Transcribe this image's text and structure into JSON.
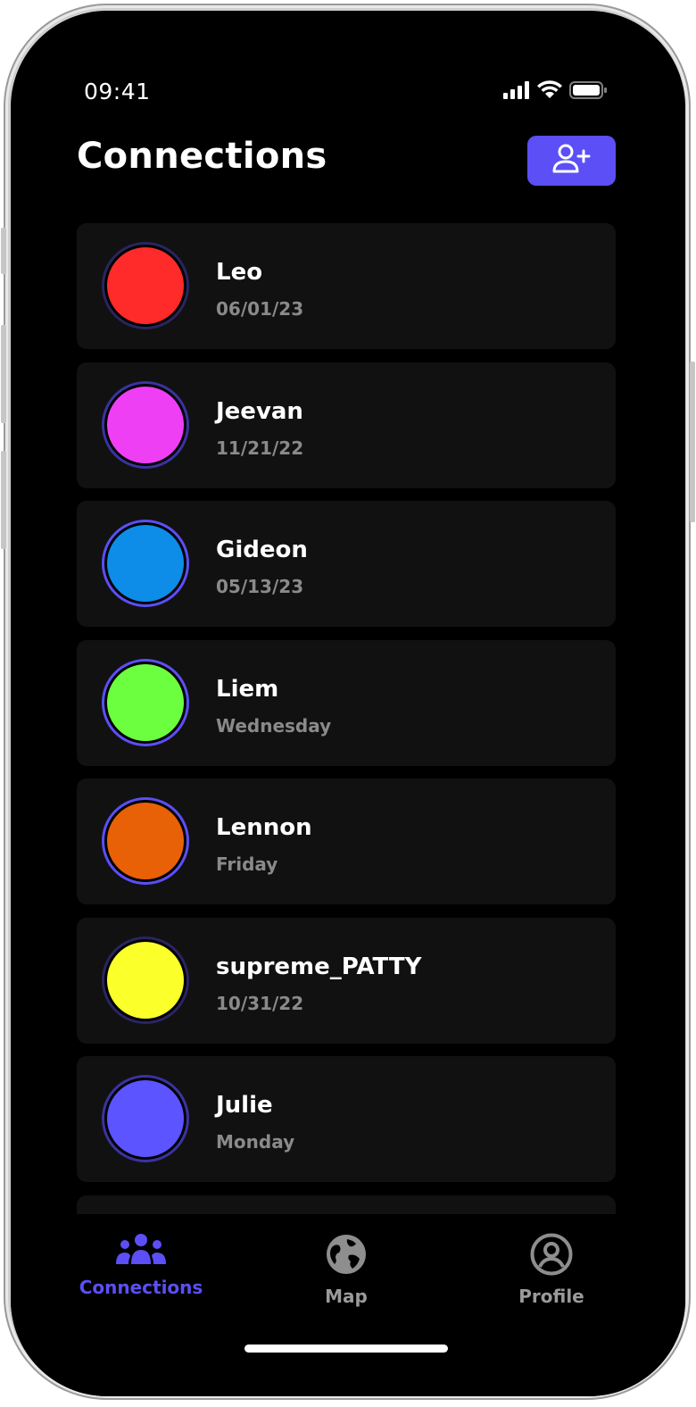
{
  "status_bar": {
    "time": "09:41",
    "icons": [
      "cellular-signal-icon",
      "wifi-icon",
      "battery-icon"
    ]
  },
  "header": {
    "title": "Connections",
    "add_button_icon": "add-user-icon"
  },
  "colors": {
    "accent": "#5b4ff5",
    "card_bg": "#111111",
    "inactive_tab": "#9a9a9a"
  },
  "connections": [
    {
      "name": "Leo",
      "date": "06/01/23",
      "color": "#ff2a2a",
      "ring": "#2a2560"
    },
    {
      "name": "Jeevan",
      "date": "11/21/22",
      "color": "#ee3ff5",
      "ring": "#3a33a0"
    },
    {
      "name": "Gideon",
      "date": "05/13/23",
      "color": "#0d8ce8",
      "ring": "#5b4ff5"
    },
    {
      "name": "Liem",
      "date": "Wednesday",
      "color": "#6cff3f",
      "ring": "#5b4ff5"
    },
    {
      "name": "Lennon",
      "date": "Friday",
      "color": "#e86106",
      "ring": "#5b4ff5"
    },
    {
      "name": "supreme_PATTY",
      "date": "10/31/22",
      "color": "#fbff2a",
      "ring": "#2a2560"
    },
    {
      "name": "Julie",
      "date": "Monday",
      "color": "#5b54ff",
      "ring": "#3a33a0"
    }
  ],
  "tabs": [
    {
      "label": "Connections",
      "icon": "people-group-icon",
      "active": true
    },
    {
      "label": "Map",
      "icon": "globe-icon",
      "active": false
    },
    {
      "label": "Profile",
      "icon": "profile-circle-icon",
      "active": false
    }
  ]
}
